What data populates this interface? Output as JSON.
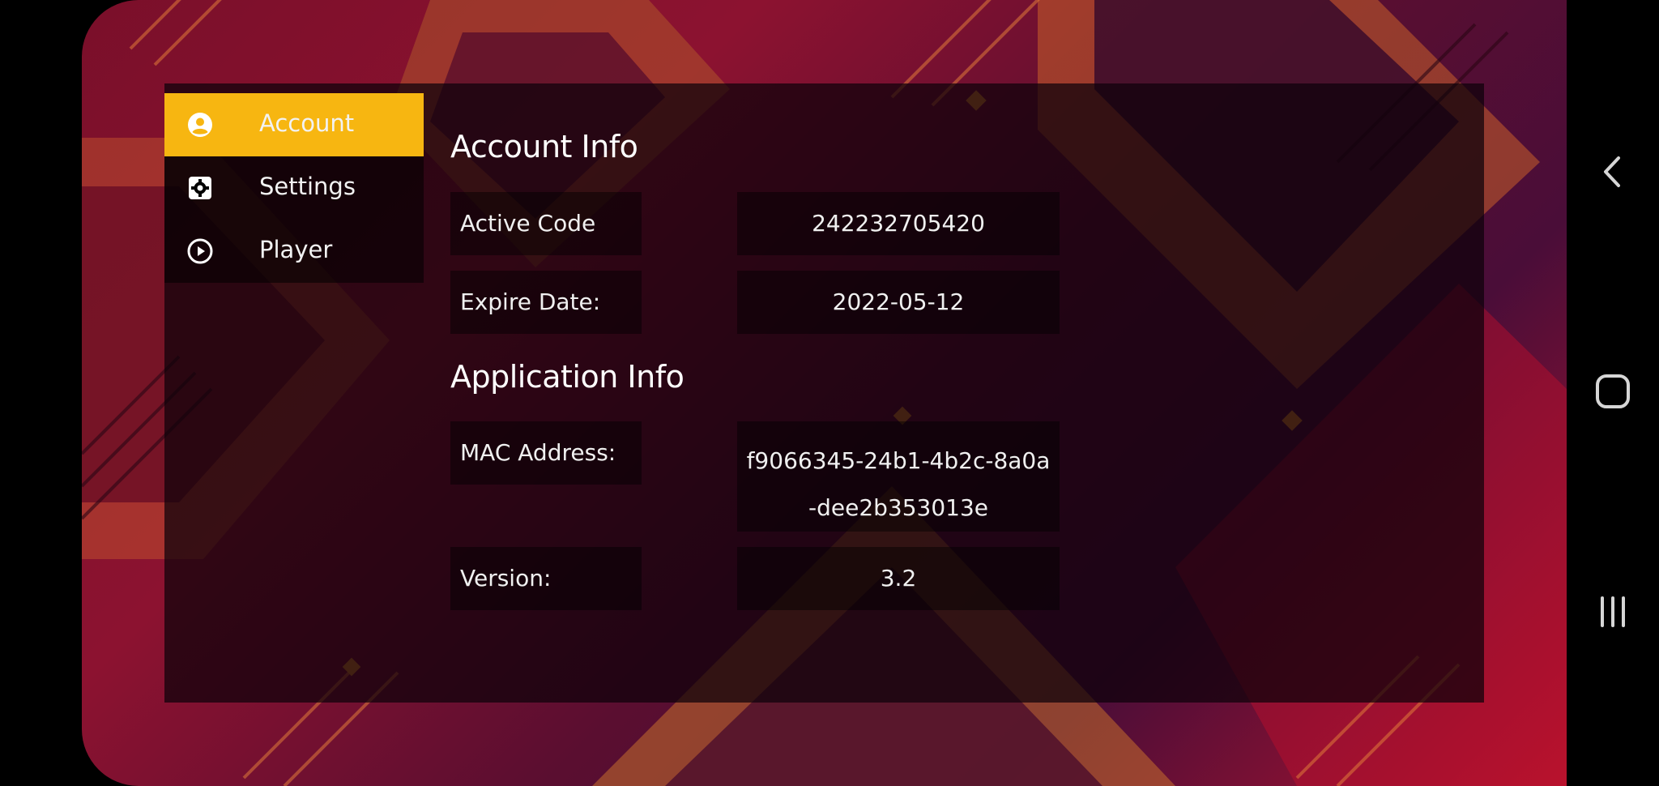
{
  "sidebar": {
    "items": [
      {
        "label": "Account",
        "icon": "user-circle-icon",
        "active": true
      },
      {
        "label": "Settings",
        "icon": "gear-icon",
        "active": false
      },
      {
        "label": "Player",
        "icon": "play-circle-icon",
        "active": false
      }
    ]
  },
  "account_info": {
    "title": "Account Info",
    "rows": [
      {
        "key": "Active Code",
        "value": "242232705420"
      },
      {
        "key": "Expire Date:",
        "value": "2022-05-12"
      }
    ]
  },
  "application_info": {
    "title": "Application Info",
    "rows": [
      {
        "key": "MAC Address:",
        "value": "f9066345-24b1-4b2c-8a0a-dee2b353013e"
      },
      {
        "key": "Version:",
        "value": "3.2"
      }
    ]
  },
  "system_nav": {
    "buttons": [
      "back-icon",
      "home-icon",
      "recents-icon"
    ]
  },
  "colors": {
    "accent": "#f7b611",
    "panel": "#0c020a"
  }
}
